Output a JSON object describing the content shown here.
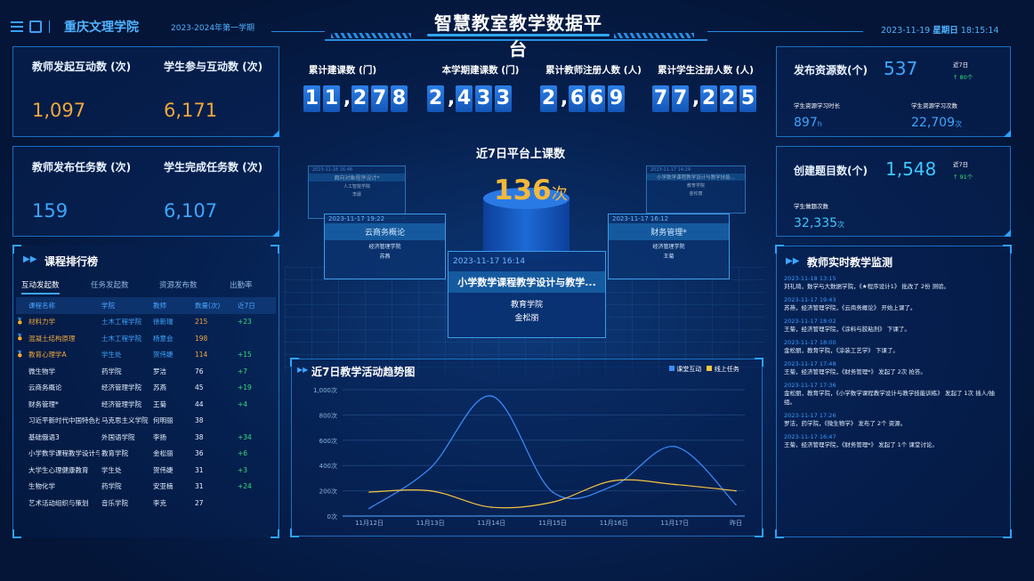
{
  "header": {
    "school": "重庆文理学院",
    "semester": "2023-2024年第一学期",
    "title": "智慧教室教学数据平台",
    "datetime": "2023-11-19",
    "weekday": "星期日",
    "time": "18:15:14"
  },
  "kpi": {
    "teacher_interact_label": "教师发起互动数 (次)",
    "teacher_interact": "1,097",
    "student_interact_label": "学生参与互动数 (次)",
    "student_interact": "6,171",
    "teacher_task_label": "教师发布任务数 (次)",
    "teacher_task": "159",
    "student_task_label": "学生完成任务数 (次)",
    "student_task": "6,107"
  },
  "totals": [
    {
      "label": "累计建课数 (门)",
      "digits": [
        "1",
        "1",
        ",",
        "2",
        "7",
        "8"
      ]
    },
    {
      "label": "本学期建课数 (门)",
      "digits": [
        "2",
        ",",
        "4",
        "3",
        "3"
      ]
    },
    {
      "label": "累计教师注册人数 (人)",
      "digits": [
        "2",
        ",",
        "6",
        "6",
        "9"
      ]
    },
    {
      "label": "累计学生注册人数 (人)",
      "digits": [
        "7",
        "7",
        ",",
        "2",
        "2",
        "5"
      ]
    }
  ],
  "center": {
    "title": "近7日平台上课数",
    "value": "136",
    "unit": "次"
  },
  "cards": [
    {
      "ts": "2023-11-18 16:48",
      "title": "面向对象程序设计*",
      "dept": "人工智能学院",
      "name": "李晨"
    },
    {
      "ts": "2023-11-17 19:22",
      "title": "云商务概论",
      "dept": "经济管理学院",
      "name": "苏燕"
    },
    {
      "ts": "2023-11-17 16:14",
      "title": "小学数学课程教学设计与教学...",
      "dept": "教育学院",
      "name": "金松丽"
    },
    {
      "ts": "2023-11-17 16:12",
      "title": "财务管理*",
      "dept": "经济管理学院",
      "name": "王菊"
    },
    {
      "ts": "2023-11-17 14:24",
      "title": "小学数学课程教学设计与教学技能...",
      "dept": "教育学院",
      "name": "金松丽"
    }
  ],
  "ranking": {
    "title": "课程排行榜",
    "tabs": [
      "互动发起数",
      "任务发起数",
      "资源发布数",
      "出勤率"
    ],
    "headers": [
      "课程名称",
      "学院",
      "教师",
      "数量(次)",
      "近7日"
    ],
    "rows": [
      [
        "材料力学",
        "土木工程学院",
        "徐新瑞",
        "215",
        "+23"
      ],
      [
        "混凝土结构原理",
        "土木工程学院",
        "杨意会",
        "198",
        ""
      ],
      [
        "教育心理学A",
        "学生处",
        "贺伟婕",
        "114",
        "+15"
      ],
      [
        "微生物学",
        "药学院",
        "罗洁",
        "76",
        "+7"
      ],
      [
        "云商务概论",
        "经济管理学院",
        "苏燕",
        "45",
        "+19"
      ],
      [
        "财务管理*",
        "经济管理学院",
        "王菊",
        "44",
        "+4"
      ],
      [
        "习近平新时代中国特色社...",
        "马克思主义学院",
        "何明丽",
        "38",
        ""
      ],
      [
        "基础俄语3",
        "外国语学院",
        "李扬",
        "38",
        "+34"
      ],
      [
        "小学数学课程教学设计与...",
        "教育学院",
        "金松丽",
        "36",
        "+6"
      ],
      [
        "大学生心理健康教育",
        "学生处",
        "贺伟婕",
        "31",
        "+3"
      ],
      [
        "生物化学",
        "药学院",
        "安亚楠",
        "31",
        "+24"
      ],
      [
        "艺术活动组织与策划",
        "音乐学院",
        "李克",
        "27",
        ""
      ]
    ]
  },
  "resources": {
    "pub_label": "发布资源数(个)",
    "pub": "537",
    "pub_7d_label": "近7日",
    "pub_7d": "↑ 80个",
    "study_time_label": "学生资源学习时长",
    "study_time": "897",
    "study_time_unit": "h",
    "study_count_label": "学生资源学习次数",
    "study_count": "22,709",
    "study_count_unit": "次",
    "topic_label": "创建题目数(个)",
    "topic": "1,548",
    "topic_7d_label": "近7日",
    "topic_7d": "↑ 91个",
    "answer_label": "学生做题次数",
    "answer": "32,335",
    "answer_unit": "次"
  },
  "monitor": {
    "title": "教师实时教学监测",
    "items": [
      {
        "ts": "2023-11-18 13:15",
        "text": "刘礼琦，数学与大数据学院，《★程序设计1》 批改了 2份 测验。"
      },
      {
        "ts": "2023-11-17 19:43",
        "text": "苏燕，经济管理学院，《云商务概论》 开始上课了。"
      },
      {
        "ts": "2023-11-17 18:02",
        "text": "王菊，经济管理学院，《涂料与胶粘剂》 下课了。"
      },
      {
        "ts": "2023-11-17 18:00",
        "text": "金松丽，教育学院，《涂装工艺学》 下课了。"
      },
      {
        "ts": "2023-11-17 17:48",
        "text": "王菊，经济管理学院，《财务管理*》 发起了 2次 抢答。"
      },
      {
        "ts": "2023-11-17 17:36",
        "text": "金松丽，教育学院，《小学数学课程教学设计与教学技能训练》 发起了 1次 插人/抽组。"
      },
      {
        "ts": "2023-11-17 17:26",
        "text": "罗洁，药学院，《微生物学》 发布了 2个 资源。"
      },
      {
        "ts": "2023-11-17 16:47",
        "text": "王菊，经济管理学院，《财务管理*》 发起了 1个 课堂讨论。"
      }
    ]
  },
  "trend": {
    "title": "近7日教学活动趋势图",
    "colors": {
      "interact": "#3a8fff",
      "task": "#f5c542"
    },
    "chart_data": {
      "type": "line",
      "categories": [
        "11月12日",
        "11月13日",
        "11月14日",
        "11月15日",
        "11月16日",
        "11月17日",
        "昨日"
      ],
      "series": [
        {
          "name": "课堂互动",
          "values": [
            60,
            380,
            950,
            190,
            240,
            550,
            90
          ]
        },
        {
          "name": "线上任务",
          "values": [
            190,
            200,
            70,
            110,
            280,
            250,
            200
          ]
        }
      ],
      "ylim": [
        0,
        1000
      ],
      "yticks": [
        "0次",
        "200次",
        "400次",
        "600次",
        "800次",
        "1,000次"
      ]
    }
  }
}
